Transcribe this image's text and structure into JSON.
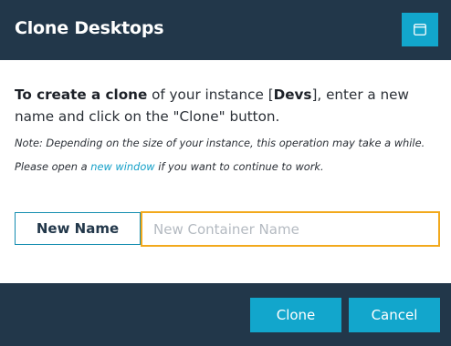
{
  "dialog": {
    "title": "Clone Desktops",
    "window_icon": "window-icon"
  },
  "description": {
    "bold_intro": "To create a clone",
    "text_1": " of your instance [",
    "instance_name": "Devs",
    "text_2": "], enter a new name and click on the \"Clone\" button."
  },
  "note": {
    "text_1": "Note: Depending on the size of your instance, this operation may take a while. Please open a ",
    "link": "new window",
    "text_2": " if you want to continue to work."
  },
  "form": {
    "name_label": "New Name",
    "name_value": "",
    "name_placeholder": "New Container Name"
  },
  "buttons": {
    "clone": "Clone",
    "cancel": "Cancel"
  },
  "colors": {
    "header_bg": "#22374a",
    "accent": "#12a6cc",
    "input_focus_border": "#f2a91c",
    "link": "#14a0c8"
  }
}
